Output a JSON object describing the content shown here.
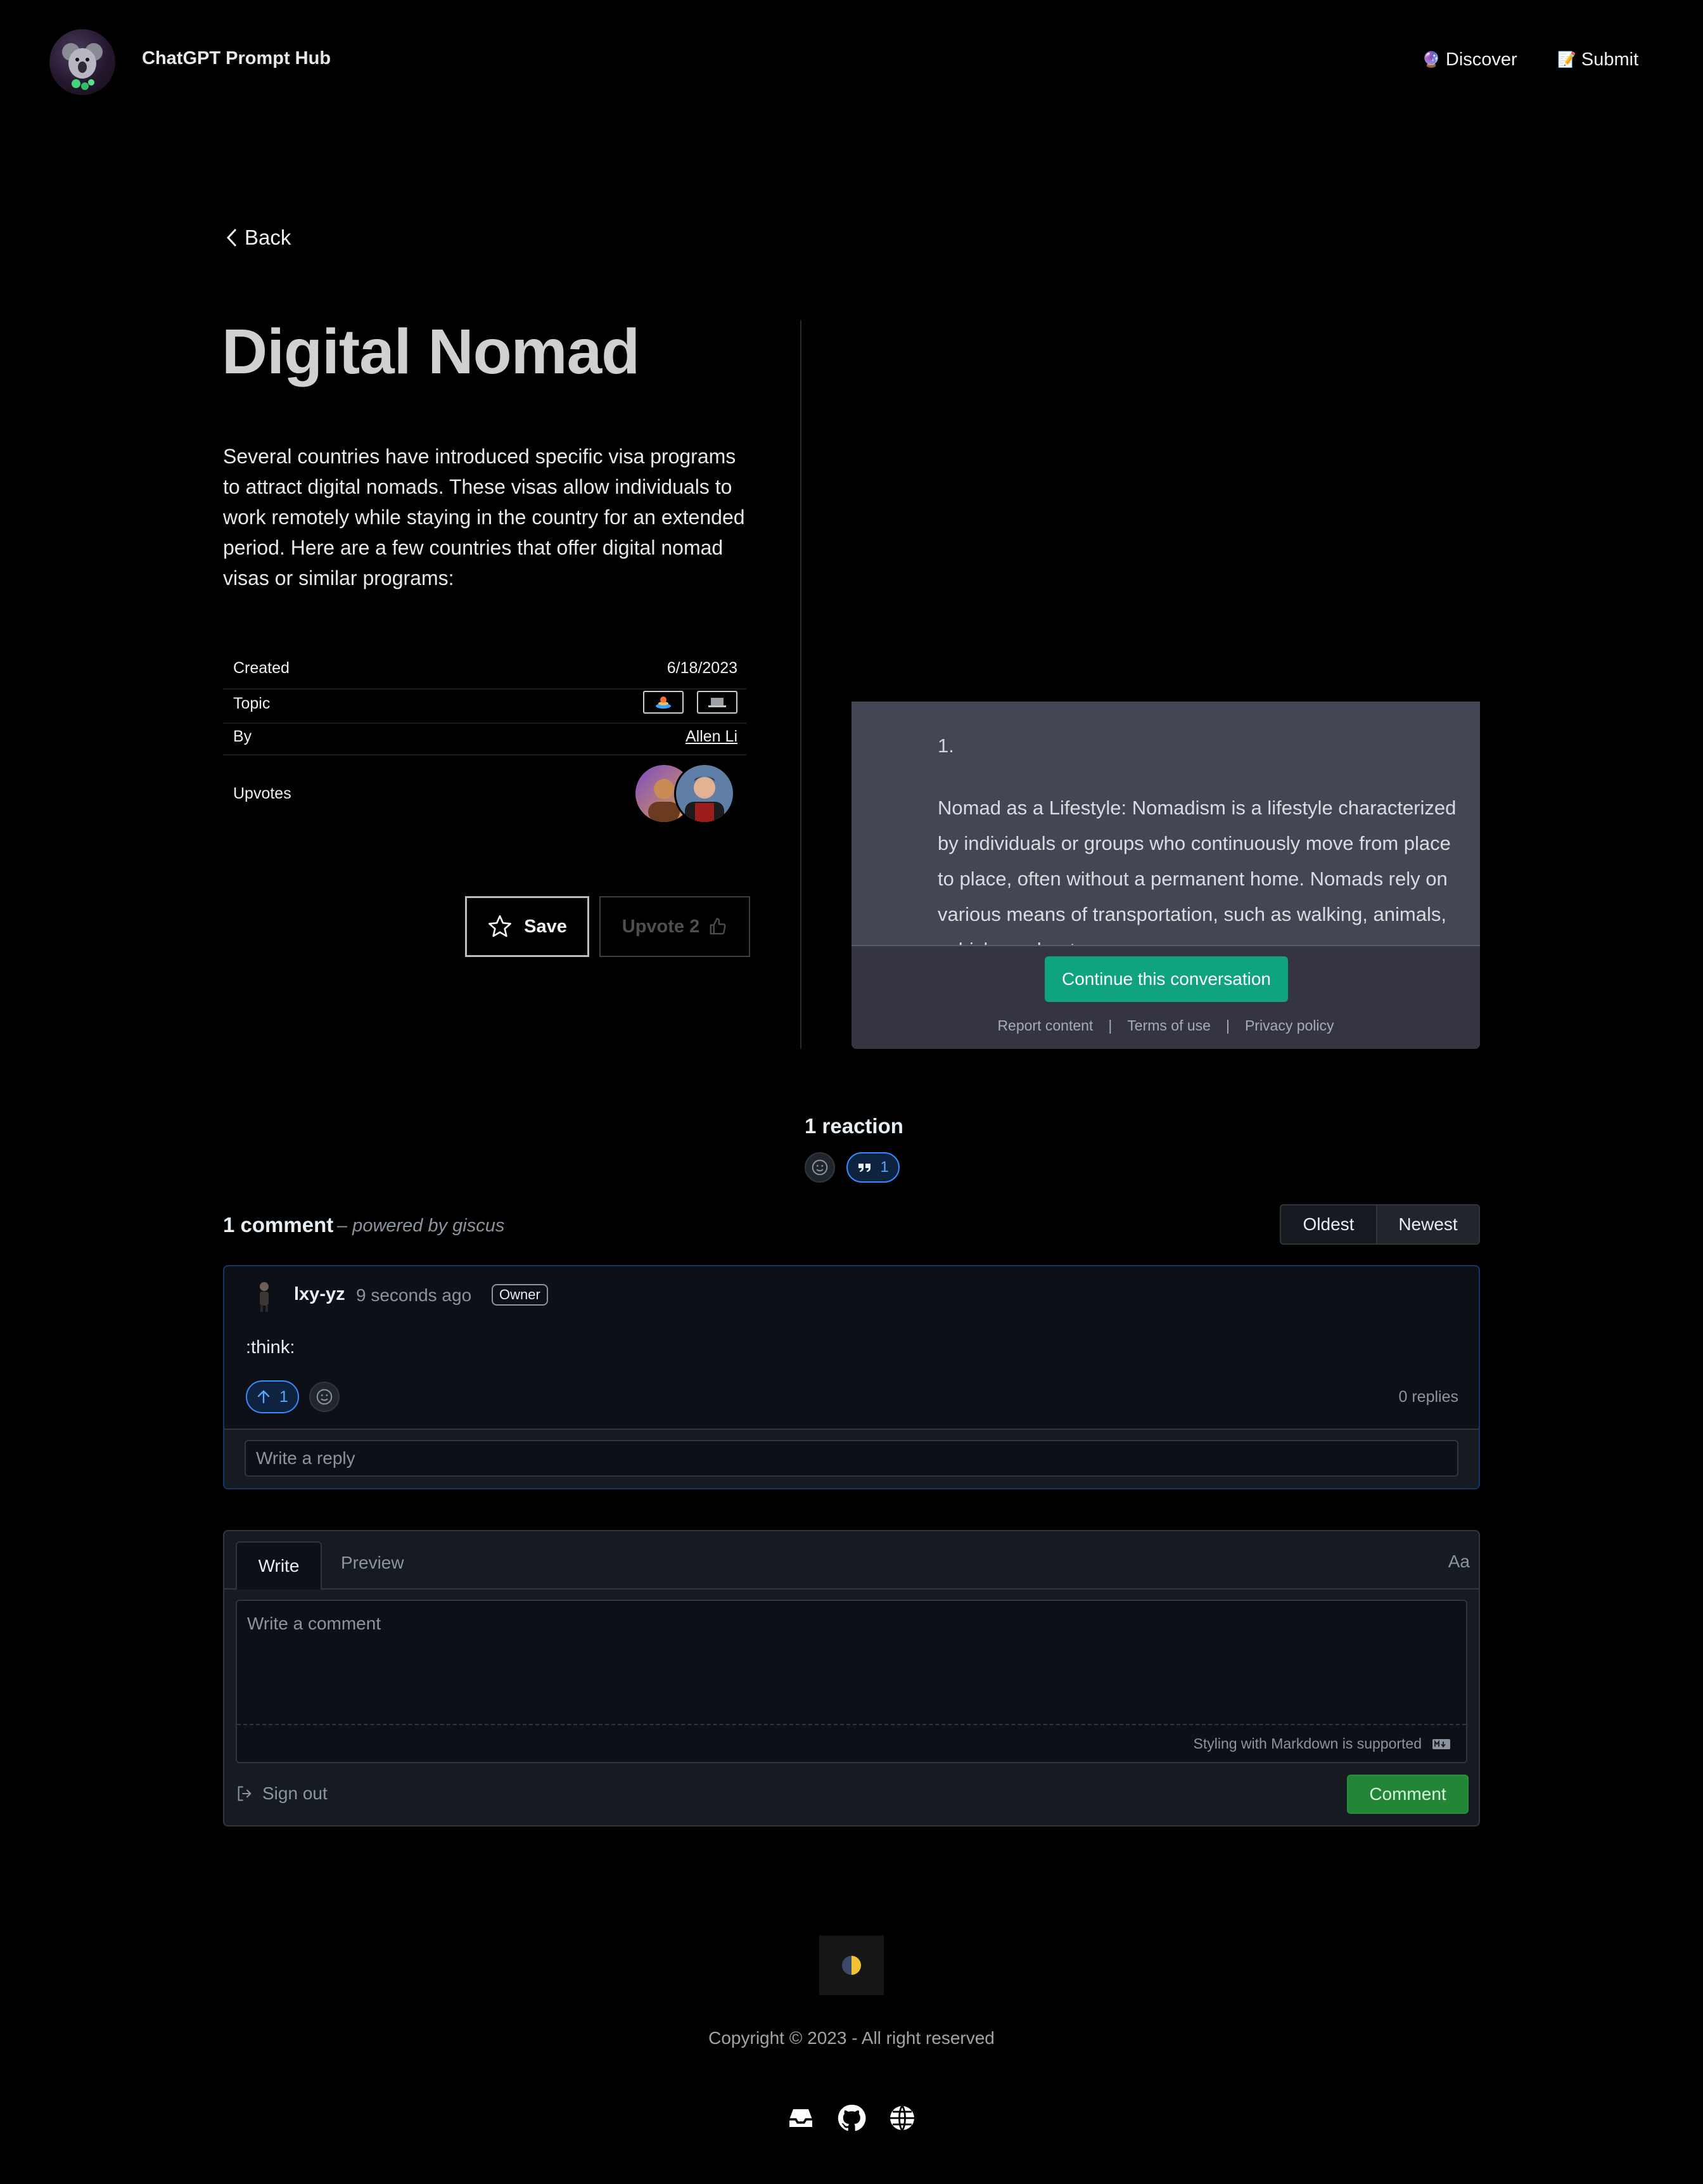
{
  "header": {
    "site_title": "ChatGPT Prompt Hub",
    "nav": [
      {
        "emoji": "🔮",
        "label": "Discover"
      },
      {
        "emoji": "📝",
        "label": "Submit"
      }
    ]
  },
  "back_label": "Back",
  "prompt": {
    "title": "Digital Nomad",
    "description": "Several countries have introduced specific visa programs to attract digital nomads. These visas allow individuals to work remotely while staying in the country for an extended period. Here are a few countries that offer digital nomad visas or similar programs:",
    "meta": {
      "created_label": "Created",
      "created_value": "6/18/2023",
      "topic_label": "Topic",
      "by_label": "By",
      "by_value": "Allen Li",
      "upvotes_label": "Upvotes"
    },
    "save_label": "Save",
    "upvote_label": "Upvote 2"
  },
  "chat_preview": {
    "list_number": "1.",
    "text": "Nomad as a Lifestyle: Nomadism is a lifestyle characterized by individuals or groups who continuously move from place to place, often without a permanent home. Nomads rely on various means of transportation, such as walking, animals, vehicles or boats.",
    "continue_label": "Continue this conversation",
    "links": [
      "Report content",
      "Terms of use",
      "Privacy policy"
    ],
    "link_separator": "|"
  },
  "reactions": {
    "title": "1 reaction",
    "quote_count": "1"
  },
  "comments": {
    "count_label": "1 comment",
    "powered_by": "– powered by giscus",
    "sort": [
      "Oldest",
      "Newest"
    ],
    "items": [
      {
        "author": "lxy-yz",
        "time": "9 seconds ago",
        "badge": "Owner",
        "body": ":think:",
        "upvotes": "1",
        "replies": "0 replies",
        "reply_placeholder": "Write a reply"
      }
    ]
  },
  "composer": {
    "tab_write": "Write",
    "tab_preview": "Preview",
    "font_toggle": "Aa",
    "placeholder": "Write a comment",
    "markdown_note": "Styling with Markdown is supported",
    "sign_out": "Sign out",
    "submit": "Comment"
  },
  "footer": {
    "copyright": "Copyright © 2023 - All right reserved",
    "icons": [
      "inbox-icon",
      "github-icon",
      "globe-icon"
    ]
  },
  "colors": {
    "accent_green": "#10a37f",
    "github_blue": "#58a6ff",
    "comment_green": "#238636"
  }
}
